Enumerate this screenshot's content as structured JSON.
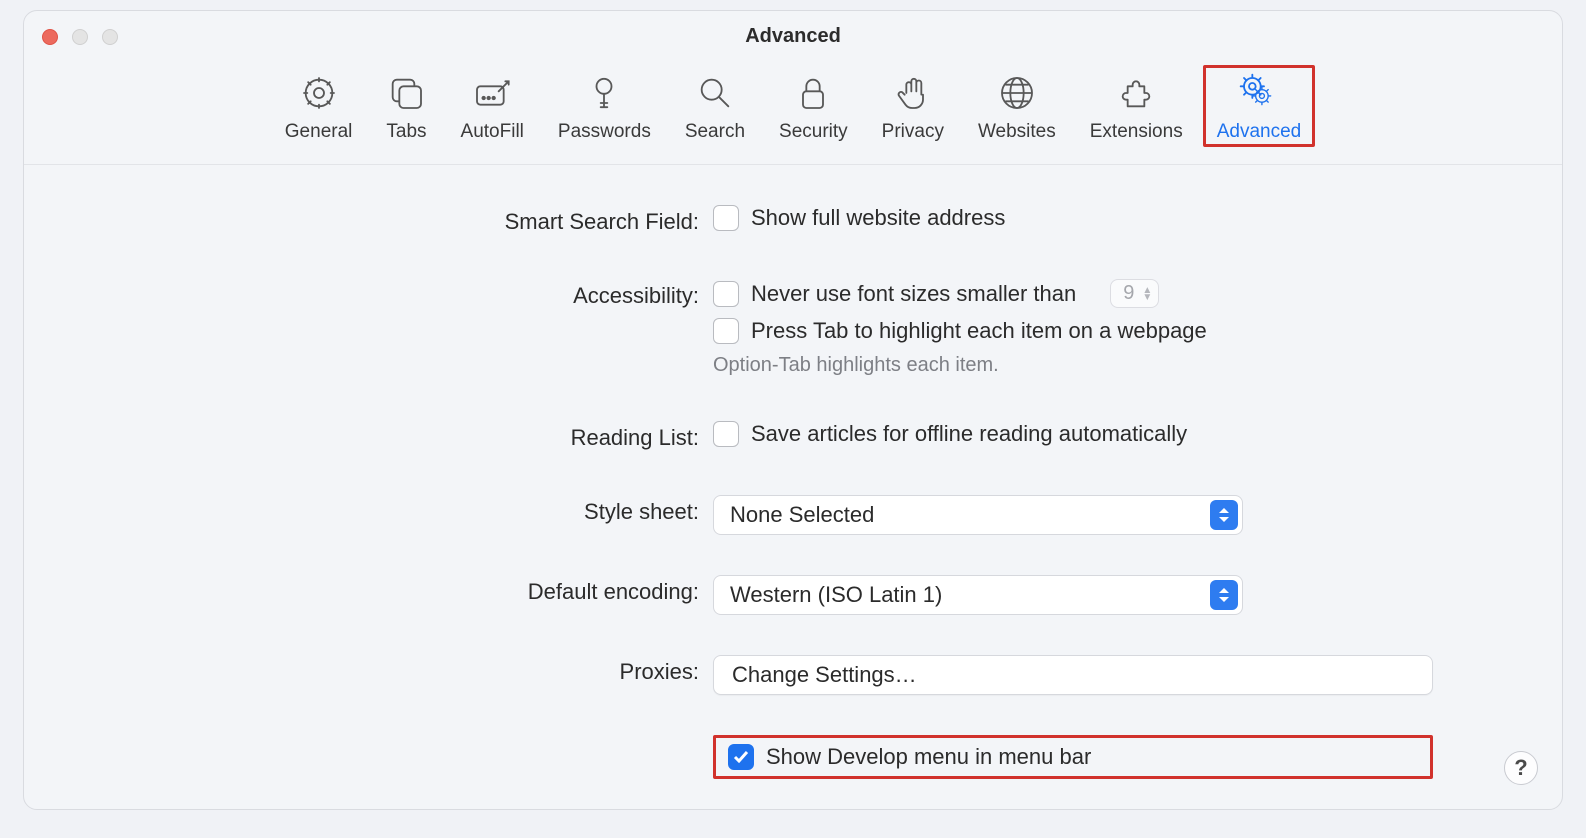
{
  "window": {
    "title": "Advanced"
  },
  "toolbar": {
    "items": [
      {
        "label": "General"
      },
      {
        "label": "Tabs"
      },
      {
        "label": "AutoFill"
      },
      {
        "label": "Passwords"
      },
      {
        "label": "Search"
      },
      {
        "label": "Security"
      },
      {
        "label": "Privacy"
      },
      {
        "label": "Websites"
      },
      {
        "label": "Extensions"
      },
      {
        "label": "Advanced"
      }
    ]
  },
  "sections": {
    "smart_search": {
      "label": "Smart Search Field:",
      "option": "Show full website address"
    },
    "accessibility": {
      "label": "Accessibility:",
      "font_option_prefix": "Never use font sizes smaller than",
      "font_value": "9",
      "tab_option": "Press Tab to highlight each item on a webpage",
      "hint": "Option-Tab highlights each item."
    },
    "reading_list": {
      "label": "Reading List:",
      "option": "Save articles for offline reading automatically"
    },
    "stylesheet": {
      "label": "Style sheet:",
      "value": "None Selected"
    },
    "encoding": {
      "label": "Default encoding:",
      "value": "Western (ISO Latin 1)"
    },
    "proxies": {
      "label": "Proxies:",
      "button": "Change Settings…"
    },
    "develop": {
      "option": "Show Develop menu in menu bar"
    }
  },
  "help": "?"
}
